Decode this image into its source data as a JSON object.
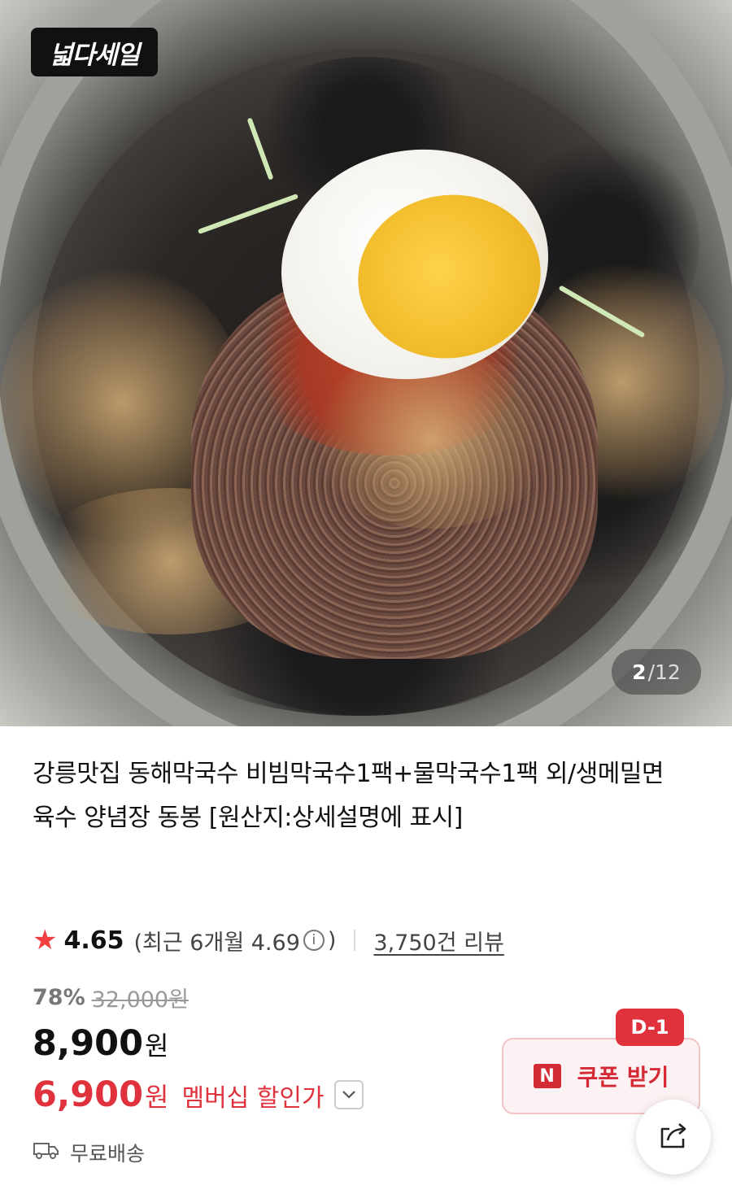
{
  "hero": {
    "badge": "넓다세일",
    "counter_current": "2",
    "counter_total": "12"
  },
  "product": {
    "title": "강릉맛집 동해막국수 비빔막국수1팩+물막국수1팩 외/생메밀면 육수 양념장 동봉 [원산지:상세설명에 표시]"
  },
  "rating": {
    "star_icon": "star-icon",
    "value": "4.65",
    "recent_prefix": "(최근 6개월 4.69",
    "info_icon": "info-icon",
    "recent_suffix": ")",
    "review_count": "3,750건 리뷰"
  },
  "pricing": {
    "discount_rate": "78%",
    "original_price": "32,000원",
    "price": "8,900",
    "price_unit": "원",
    "member_price": "6,900",
    "member_unit": "원",
    "member_label": "멤버십 할인가"
  },
  "shipping": {
    "label": "무료배송"
  },
  "coupon": {
    "dday": "D-1",
    "brand_mark": "N",
    "label": "쿠폰 받기"
  },
  "colors": {
    "accent_red": "#e0323c",
    "star": "#f04040"
  }
}
